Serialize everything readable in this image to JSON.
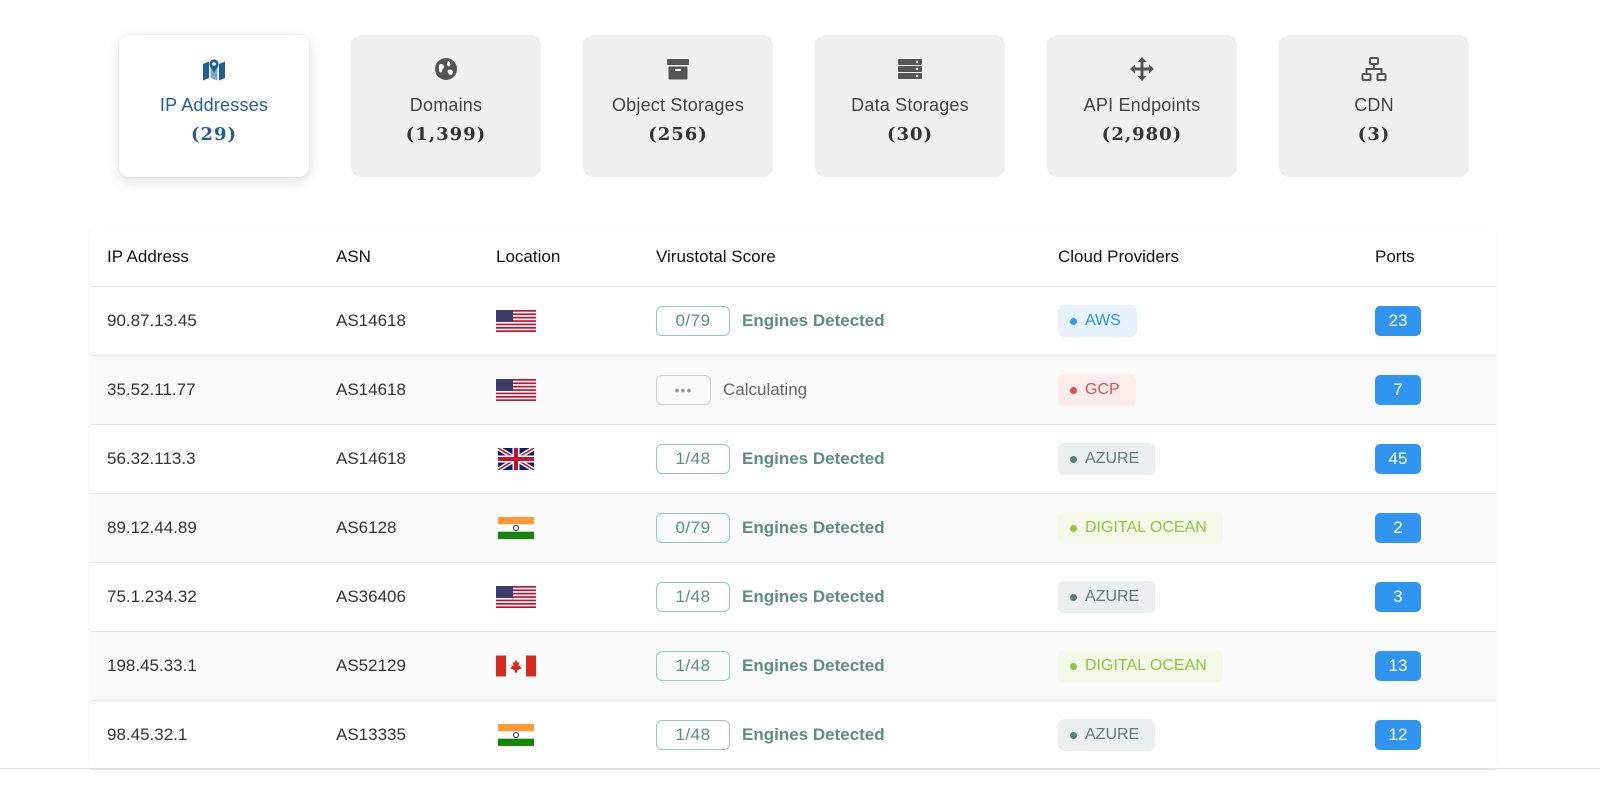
{
  "categories": [
    {
      "label": "IP Addresses",
      "count": "(29)",
      "icon": "map-pin-icon",
      "active": true
    },
    {
      "label": "Domains",
      "count": "(1,399)",
      "icon": "globe-icon",
      "active": false
    },
    {
      "label": "Object Storages",
      "count": "(256)",
      "icon": "archive-box-icon",
      "active": false
    },
    {
      "label": "Data Storages",
      "count": "(30)",
      "icon": "server-icon",
      "active": false
    },
    {
      "label": "API Endpoints",
      "count": "(2,980)",
      "icon": "arrows-move-icon",
      "active": false
    },
    {
      "label": "CDN",
      "count": "(3)",
      "icon": "network-icon",
      "active": false
    }
  ],
  "colors": {
    "active_blue": "#1f5f99",
    "card_bg": "#f0f0f0",
    "score_green": "#5b8f80",
    "port_blue": "#2f95f0"
  },
  "table": {
    "headers": {
      "ip": "IP Address",
      "asn": "ASN",
      "location": "Location",
      "score": "Virustotal Score",
      "providers": "Cloud Providers",
      "ports": "Ports"
    },
    "rows": [
      {
        "ip": "90.87.13.45",
        "asn": "AS14618",
        "flag": "us",
        "score": "0/79",
        "score_text": "Engines Detected",
        "provider": "AWS",
        "provider_style": "aws",
        "ports": "23"
      },
      {
        "ip": "35.52.11.77",
        "asn": "AS14618",
        "flag": "us",
        "score": "•••",
        "score_text": "Calculating",
        "calculating": true,
        "provider": "GCP",
        "provider_style": "gcp",
        "ports": "7"
      },
      {
        "ip": "56.32.113.3",
        "asn": "AS14618",
        "flag": "uk",
        "score": "1/48",
        "score_text": "Engines Detected",
        "provider": "AZURE",
        "provider_style": "azure",
        "ports": "45"
      },
      {
        "ip": "89.12.44.89",
        "asn": "AS6128",
        "flag": "in",
        "score": "0/79",
        "score_text": "Engines Detected",
        "provider": "DIGITAL OCEAN",
        "provider_style": "do",
        "ports": "2"
      },
      {
        "ip": "75.1.234.32",
        "asn": "AS36406",
        "flag": "us",
        "score": "1/48",
        "score_text": "Engines Detected",
        "provider": "AZURE",
        "provider_style": "azure",
        "ports": "3"
      },
      {
        "ip": "198.45.33.1",
        "asn": "AS52129",
        "flag": "ca",
        "score": "1/48",
        "score_text": "Engines Detected",
        "provider": "DIGITAL OCEAN",
        "provider_style": "do",
        "ports": "13"
      },
      {
        "ip": "98.45.32.1",
        "asn": "AS13335",
        "flag": "in",
        "score": "1/48",
        "score_text": "Engines Detected",
        "provider": "AZURE",
        "provider_style": "azure",
        "ports": "12"
      }
    ]
  },
  "provider_styles": {
    "aws": {
      "bg": "#e6f3fc",
      "fg": "#2f95f0",
      "dot": "#2f95f0"
    },
    "gcp": {
      "bg": "#fdeceb",
      "fg": "#d9534f",
      "dot": "#d9534f"
    },
    "azure": {
      "bg": "#eceff0",
      "fg": "#5d7f72",
      "dot": "#5d7f72"
    },
    "do": {
      "bg": "#f4f9e9",
      "fg": "#8cc63f",
      "dot": "#8cc63f"
    }
  }
}
